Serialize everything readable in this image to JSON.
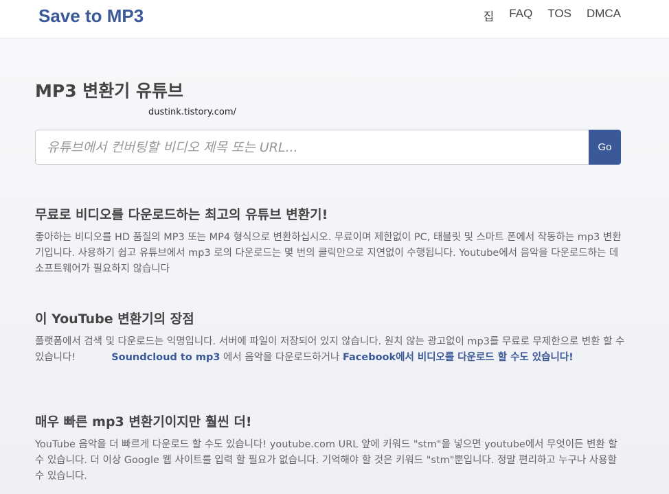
{
  "header": {
    "logo": "Save to MP3",
    "nav": [
      "집",
      "FAQ",
      "TOS",
      "DMCA"
    ]
  },
  "main": {
    "title": "MP3 변환기 유튜브",
    "site_url": "dustink.tistory.com/",
    "search": {
      "placeholder": "유튜브에서 컨버팅할 비디오 제목 또는 URL...",
      "value": "",
      "button_label": "Go"
    }
  },
  "sections": [
    {
      "heading": "무료로 비디오를 다운로드하는 최고의 유튜브 변환기!",
      "body": "좋아하는 비디오를 HD 품질의 MP3 또는 MP4 형식으로 변환하십시오. 무료이며 제한없이 PC, 태블릿 및 스마트 폰에서 작동하는 mp3 변환기입니다. 사용하기 쉽고 유튜브에서 mp3 로의 다운로드는 몇 번의 클릭만으로 지연없이 수행됩니다. Youtube에서 음악을 다운로드하는 데 소프트웨어가 필요하지 않습니다"
    },
    {
      "heading": "이 YouTube 변환기의 장점",
      "body_start": "플랫폼에서 검색 및 다운로드는 익명입니다. 서버에 파일이 저장되어 있지 않습니다. 원치 않는 광고없이 mp3를 무료로 무제한으로 변환 할 수 있습니다!",
      "link1": "Soundcloud to mp3",
      "body_mid": " 에서 음악을 다운로드하거나 ",
      "link2": "Facebook에서 비디오를 다운로드 할 수도 있습니다!"
    },
    {
      "heading": "매우 빠른 mp3 변환기이지만 훨씬 더!",
      "body": "YouTube 음악을 더 빠르게 다운로드 할 수도 있습니다! youtube.com URL 앞에 키워드 \"stm\"을 넣으면 youtube에서 무엇이든 변환 할 수 있습니다. 더 이상 Google 웹 사이트를 입력 할 필요가 없습니다. 기억해야 할 것은 키워드 \"stm\"뿐입니다. 정말 편리하고 누구나 사용할 수 있습니다."
    }
  ]
}
